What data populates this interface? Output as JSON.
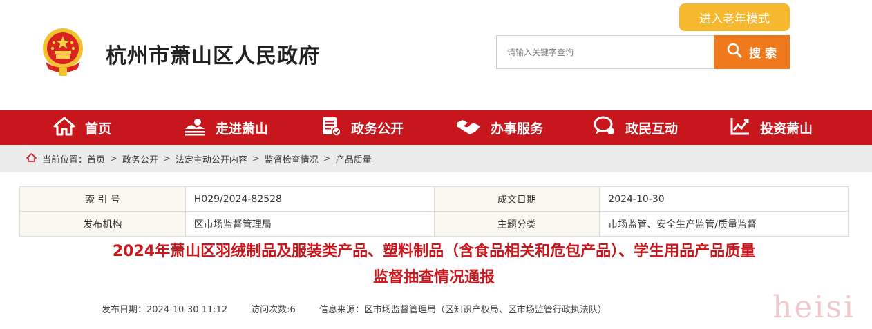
{
  "header": {
    "site_title": "杭州市萧山区人民政府",
    "elder_mode_label": "进入老年模式",
    "search_placeholder": "请输入关键字查询",
    "search_button_label": "搜 索",
    "brand_color": "#c8161d",
    "search_button_color": "#ef7a1e",
    "elder_button_color": "#f5b82e"
  },
  "nav": {
    "items": [
      {
        "label": "首页",
        "icon": "home-icon"
      },
      {
        "label": "走进萧山",
        "icon": "landscape-icon"
      },
      {
        "label": "政务公开",
        "icon": "document-icon"
      },
      {
        "label": "办事服务",
        "icon": "handshake-icon"
      },
      {
        "label": "政民互动",
        "icon": "chat-icon"
      },
      {
        "label": "投资萧山",
        "icon": "chart-icon"
      }
    ]
  },
  "breadcrumb": {
    "prefix": "当前位置：",
    "items": [
      "首页",
      "政务公开",
      "法定主动公开内容",
      "监督检查情况",
      "产品质量"
    ]
  },
  "meta": {
    "index_label": "索 引 号",
    "index_value": "H029/2024-82528",
    "date_label": "成文日期",
    "date_value": "2024-10-30",
    "publisher_label": "发布机构",
    "publisher_value": "区市场监督管理局",
    "topic_label": "主题分类",
    "topic_value": "市场监管、安全生产监管/质量监督"
  },
  "article": {
    "title_line1": "2024年萧山区羽绒制品及服装类产品、塑料制品（含食品相关和危包产品）、学生用品产品质量",
    "title_line2": "监督抽查情况通报",
    "publish_date": "发布日期：2024-10-30 11:12",
    "visits": "访问次数:6",
    "source": "信息来源：区市场监督管理局（区知识产权局、区市场监管行政执法队）"
  },
  "watermark": "heisi"
}
